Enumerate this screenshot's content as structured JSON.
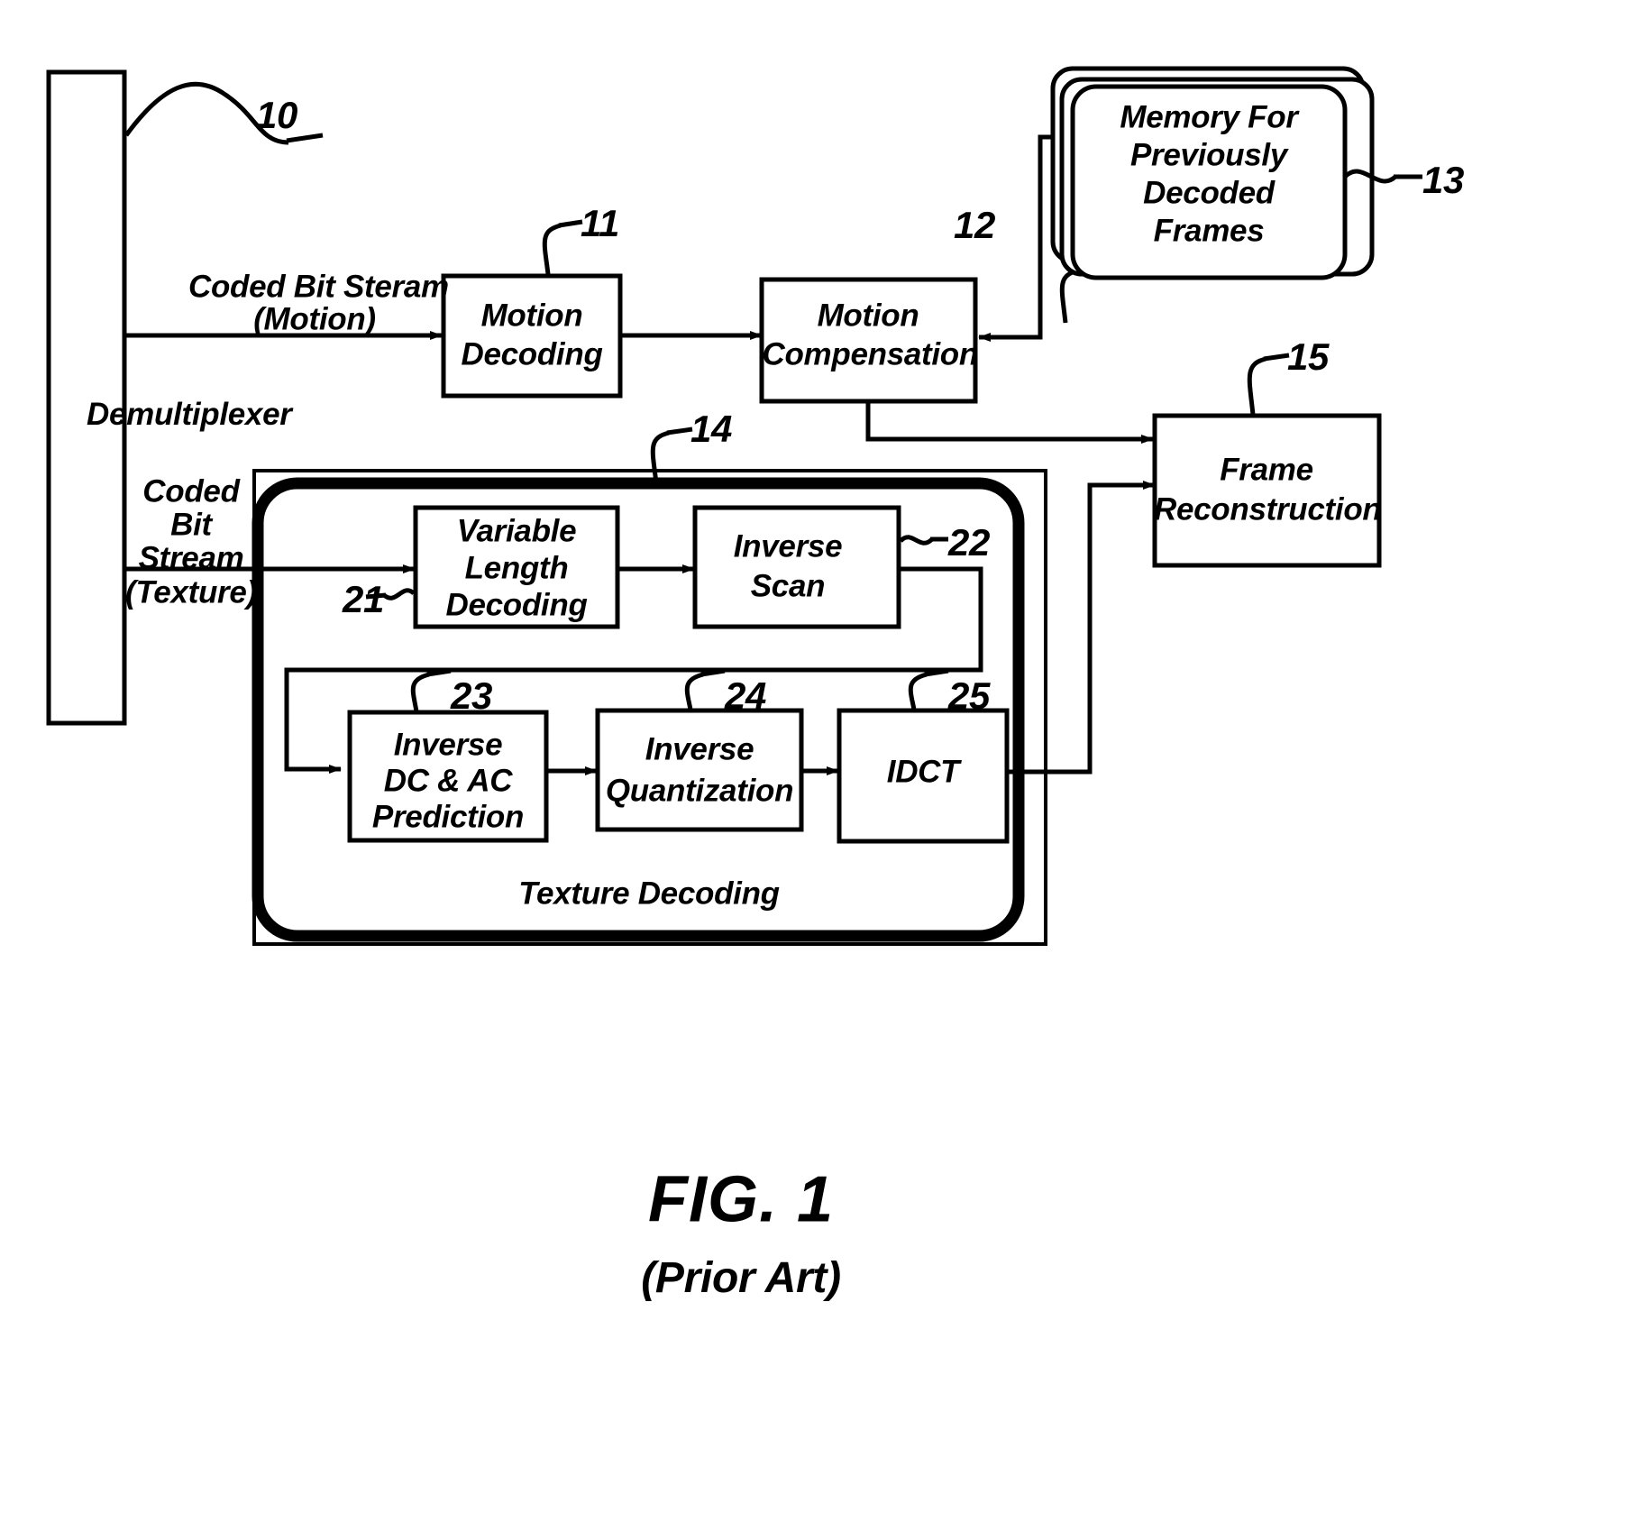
{
  "figure": {
    "caption": "FIG. 1",
    "subcaption": "(Prior Art)"
  },
  "labels": {
    "demultiplexer": "Demultiplexer",
    "coded_bit_stream_motion_line1": "Coded Bit Steram",
    "coded_bit_stream_motion_line2": "(Motion)",
    "coded_bit_stream_texture_line1": "Coded",
    "coded_bit_stream_texture_line2": "Bit",
    "coded_bit_stream_texture_line3": "Stream",
    "coded_bit_stream_texture_line4": "(Texture)",
    "texture_decoding": "Texture Decoding"
  },
  "blocks": [
    {
      "id": "motion-decoding",
      "label": "Motion\nDecoding",
      "ref": "11"
    },
    {
      "id": "motion-compensation",
      "label": "Motion\nCompensation",
      "ref": "12"
    },
    {
      "id": "memory-frames",
      "label": "Memory For\nPreviously\nDecoded\nFrames",
      "ref": "13"
    },
    {
      "id": "frame-reconstruction",
      "label": "Frame\nReconstruction",
      "ref": "15"
    },
    {
      "id": "variable-length-decoding",
      "label": "Variable\nLength\nDecoding",
      "ref": "21"
    },
    {
      "id": "inverse-scan",
      "label": "Inverse\nScan",
      "ref": "22"
    },
    {
      "id": "inverse-dc-ac-prediction",
      "label": "Inverse\nDC & AC\nPrediction",
      "ref": "23"
    },
    {
      "id": "inverse-quantization",
      "label": "Inverse\nQuantization",
      "ref": "24"
    },
    {
      "id": "idct",
      "label": "IDCT",
      "ref": "25"
    }
  ],
  "refs": {
    "demux": "10",
    "motion_decoding": "11",
    "motion_compensation": "12",
    "memory": "13",
    "texture_decoding": "14",
    "frame_reconstruction": "15",
    "vld": "21",
    "inverse_scan": "22",
    "inverse_dc_ac": "23",
    "inverse_quant": "24",
    "idct": "25"
  },
  "block_text": {
    "motion_decoding_1": "Motion",
    "motion_decoding_2": "Decoding",
    "motion_compensation_1": "Motion",
    "motion_compensation_2": "Compensation",
    "memory_1": "Memory For",
    "memory_2": "Previously",
    "memory_3": "Decoded",
    "memory_4": "Frames",
    "frame_reconstruction_1": "Frame",
    "frame_reconstruction_2": "Reconstruction",
    "vld_1": "Variable",
    "vld_2": "Length",
    "vld_3": "Decoding",
    "inverse_scan_1": "Inverse",
    "inverse_scan_2": "Scan",
    "inverse_dc_ac_1": "Inverse",
    "inverse_dc_ac_2": "DC & AC",
    "inverse_dc_ac_3": "Prediction",
    "inverse_quant_1": "Inverse",
    "inverse_quant_2": "Quantization",
    "idct_1": "IDCT"
  },
  "colors": {
    "stroke": "#000000",
    "background": "#ffffff"
  }
}
